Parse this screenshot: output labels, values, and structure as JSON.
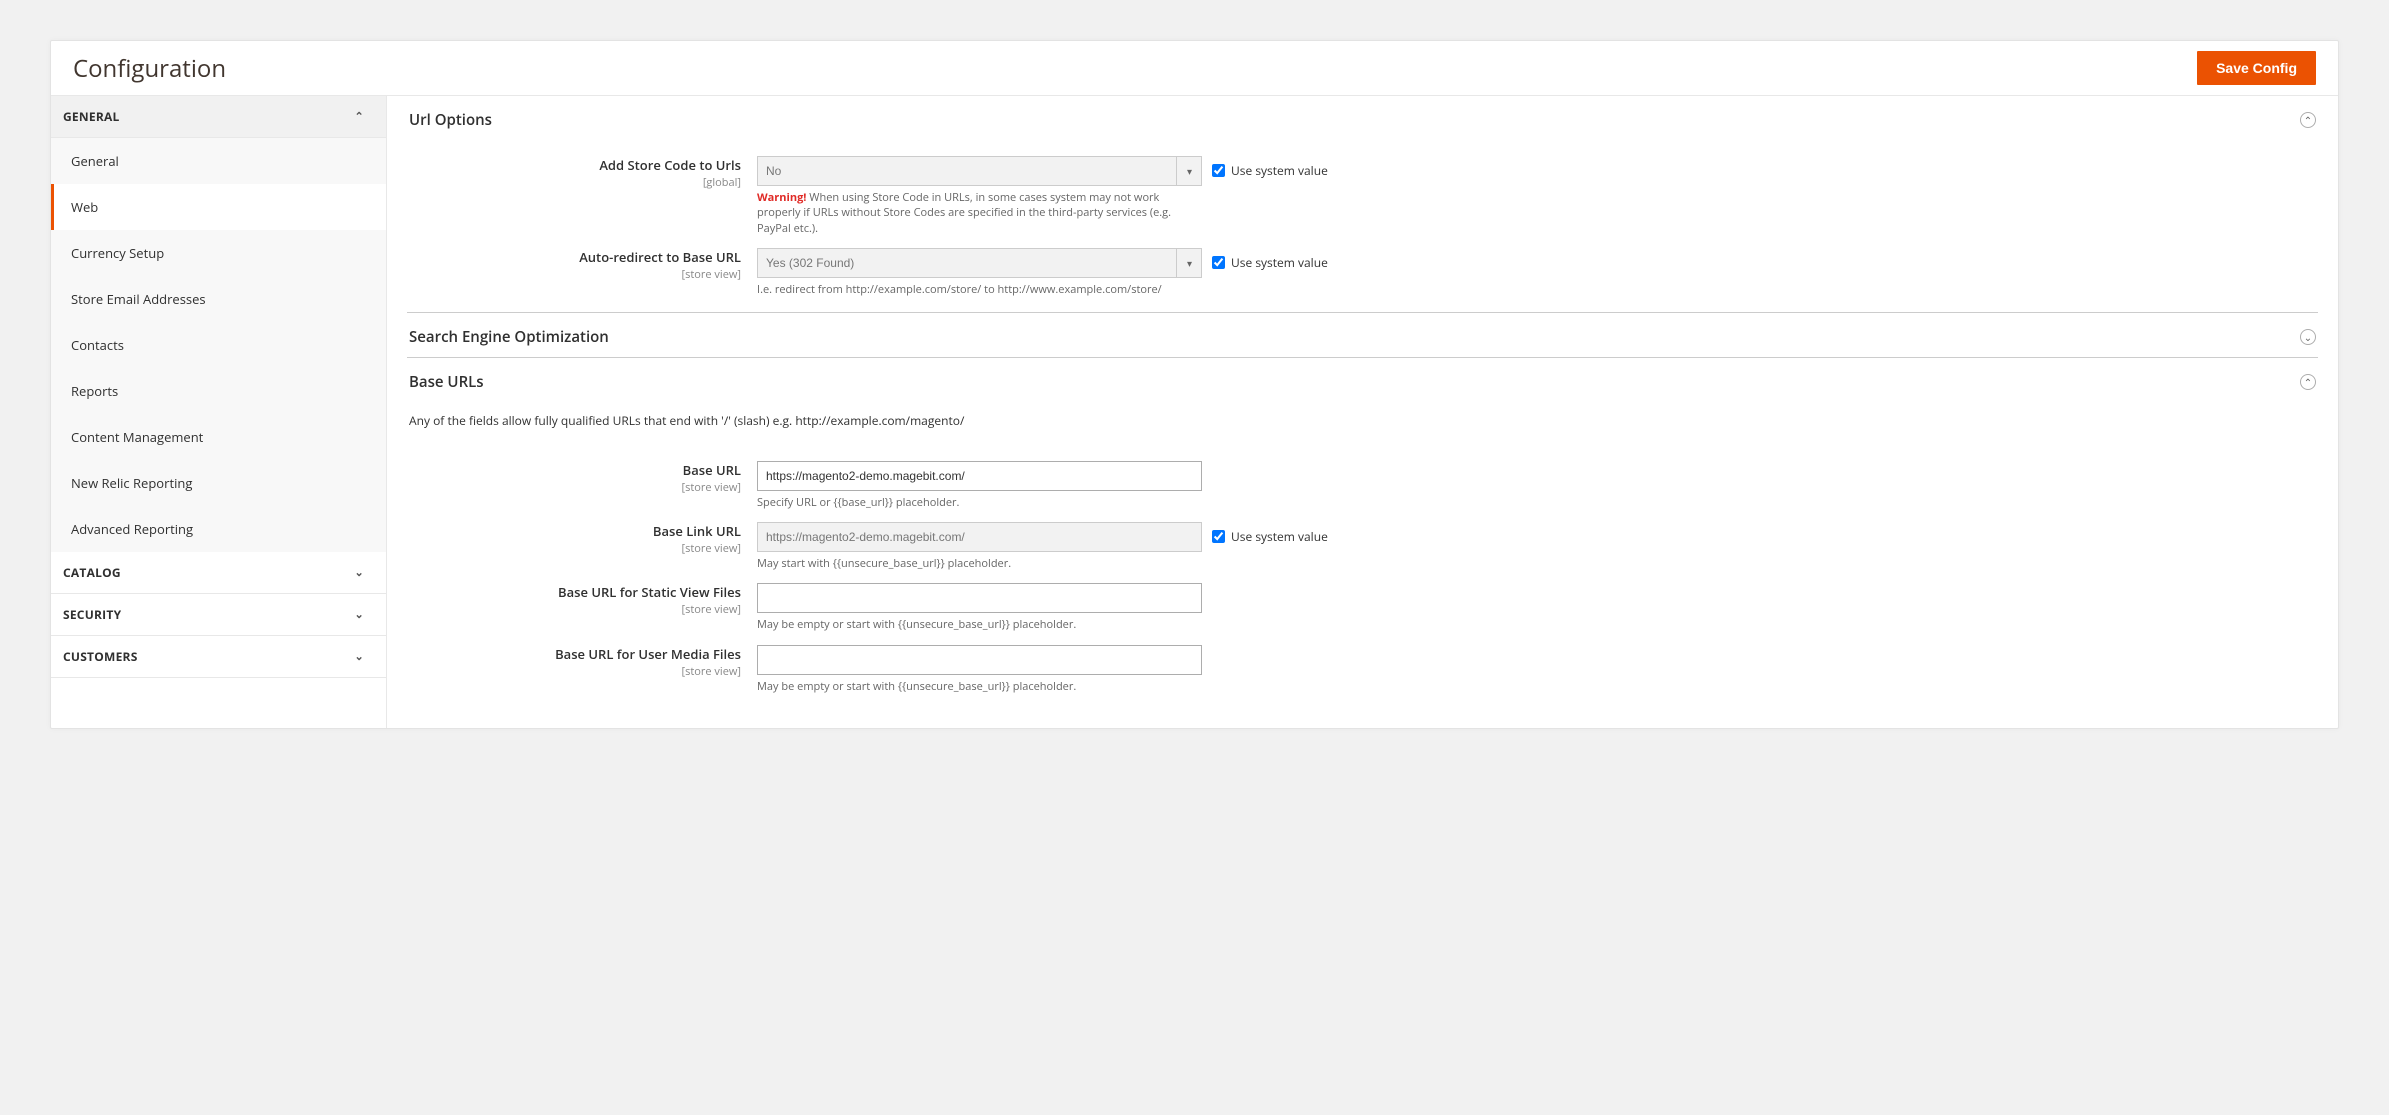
{
  "page_title": "Configuration",
  "save_button": "Save Config",
  "sidebar": {
    "sections": [
      {
        "label": "GENERAL",
        "expanded": true
      },
      {
        "label": "CATALOG",
        "expanded": false
      },
      {
        "label": "SECURITY",
        "expanded": false
      },
      {
        "label": "CUSTOMERS",
        "expanded": false
      }
    ],
    "general_items": [
      "General",
      "Web",
      "Currency Setup",
      "Store Email Addresses",
      "Contacts",
      "Reports",
      "Content Management",
      "New Relic Reporting",
      "Advanced Reporting"
    ],
    "active_item": "Web"
  },
  "sysval_label": "Use system value",
  "url_options": {
    "title": "Url Options",
    "add_store_code": {
      "label": "Add Store Code to Urls",
      "scope": "[global]",
      "value": "No",
      "note_prefix": "Warning!",
      "note": " When using Store Code in URLs, in some cases system may not work properly if URLs without Store Codes are specified in the third-party services (e.g. PayPal etc.)."
    },
    "auto_redirect": {
      "label": "Auto-redirect to Base URL",
      "scope": "[store view]",
      "value": "Yes (302 Found)",
      "note": "I.e. redirect from http://example.com/store/ to http://www.example.com/store/"
    }
  },
  "seo": {
    "title": "Search Engine Optimization"
  },
  "base_urls": {
    "title": "Base URLs",
    "intro": "Any of the fields allow fully qualified URLs that end with '/' (slash) e.g. http://example.com/magento/",
    "base_url": {
      "label": "Base URL",
      "scope": "[store view]",
      "value": "https://magento2-demo.magebit.com/",
      "note": "Specify URL or {{base_url}} placeholder."
    },
    "base_link_url": {
      "label": "Base Link URL",
      "scope": "[store view]",
      "value": "https://magento2-demo.magebit.com/",
      "note": "May start with {{unsecure_base_url}} placeholder."
    },
    "static_files": {
      "label": "Base URL for Static View Files",
      "scope": "[store view]",
      "value": "",
      "note": "May be empty or start with {{unsecure_base_url}} placeholder."
    },
    "media_files": {
      "label": "Base URL for User Media Files",
      "scope": "[store view]",
      "value": "",
      "note": "May be empty or start with {{unsecure_base_url}} placeholder."
    }
  }
}
